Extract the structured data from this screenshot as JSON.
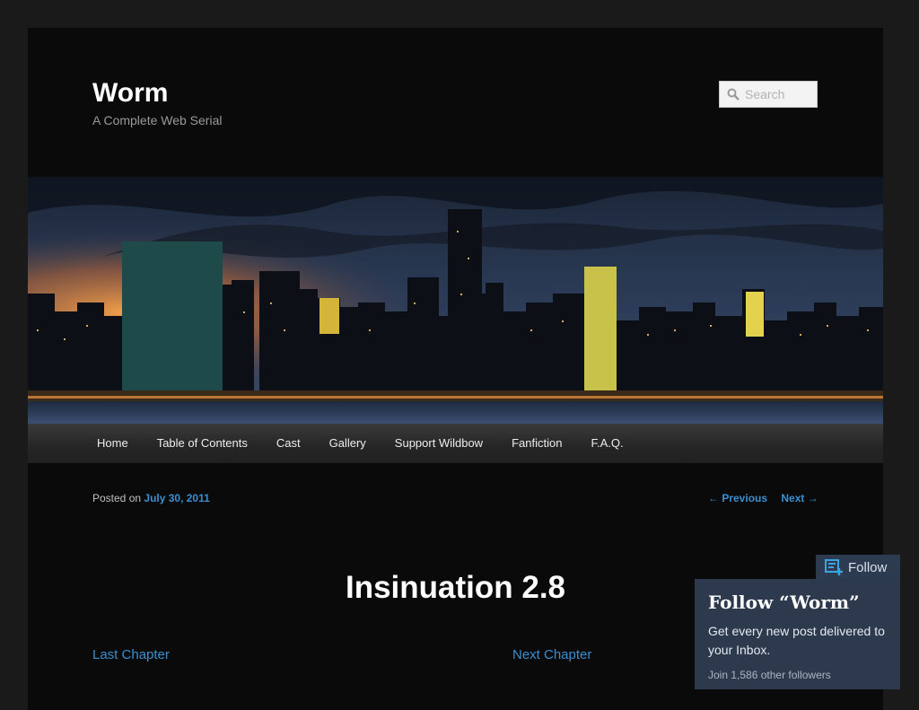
{
  "header": {
    "site_title": "Worm",
    "site_description": "A Complete Web Serial",
    "search_placeholder": "Search"
  },
  "nav": {
    "items": [
      "Home",
      "Table of Contents",
      "Cast",
      "Gallery",
      "Support Wildbow",
      "Fanfiction",
      "F.A.Q."
    ]
  },
  "post": {
    "posted_on_label": "Posted on",
    "date": "July 30, 2011",
    "previous_label": "← Previous",
    "next_label": "Next →",
    "title": "Insinuation 2.8",
    "last_chapter": "Last Chapter",
    "next_chapter": "Next Chapter"
  },
  "follow": {
    "button_label": "Follow",
    "title": "Follow “Worm”",
    "description": "Get every new post delivered to your Inbox.",
    "followers": "Join 1,586 other followers"
  },
  "colors": {
    "link": "#3a8fd0",
    "follow_panel": "#2d3a4d"
  }
}
